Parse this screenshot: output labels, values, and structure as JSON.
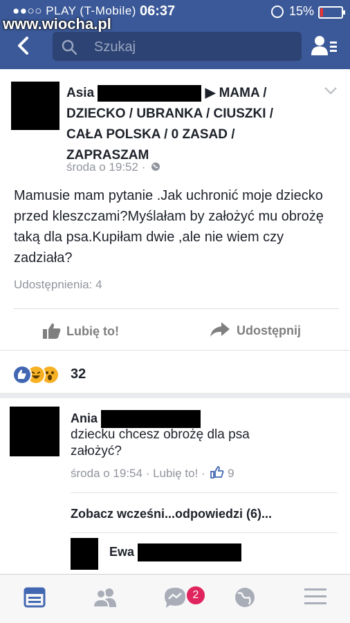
{
  "status_bar": {
    "carrier": "●●○○ PLAY (T-Mobile)",
    "time": "06:37",
    "battery": "15%"
  },
  "watermark": "www.wiocha.pl",
  "header": {
    "search_placeholder": "Szukaj",
    "icons": [
      "back-chevron-icon",
      "search-icon",
      "friends-list-icon"
    ]
  },
  "post": {
    "author": "Asia",
    "group_line_1": "▶ MAMA /",
    "group_line_2": "DZIECKO / UBRANKA / CIUSZKI /",
    "group_line_3": "CAŁA POLSKA / 0 ZASAD /",
    "group_line_4": "ZAPRASZAM",
    "time": "środa o 19:52 ·",
    "body": "Mamusie mam pytanie .Jak uchronić moje dziecko przed kleszczami?Myślałam by założyć mu obrożę taką dla psa.Kupiłam dwie ,ale nie wiem czy zadziała?",
    "shares": "Udostępnienia: 4",
    "like_label": "Lubię to!",
    "share_label": "Udostępnij",
    "reactions_count": "32"
  },
  "comment": {
    "author": "Ania",
    "text": "dziecku chcesz obrożę dla psa założyć?",
    "time": "środa o 19:54 ·",
    "like_label": "Lubię to! ·",
    "likes": "9"
  },
  "more_replies": "Zobacz wcześni...odpowiedzi (6)...",
  "reply": {
    "author": "Ewa"
  },
  "tabbar": {
    "notifications_badge": "2",
    "icons": [
      "news-feed-icon",
      "friend-requests-icon",
      "messenger-icon",
      "globe-notifications-icon",
      "menu-icon"
    ]
  },
  "colors": {
    "brand": "#3b5998",
    "like_blue": "#4267b2",
    "badge": "#e0245e"
  }
}
